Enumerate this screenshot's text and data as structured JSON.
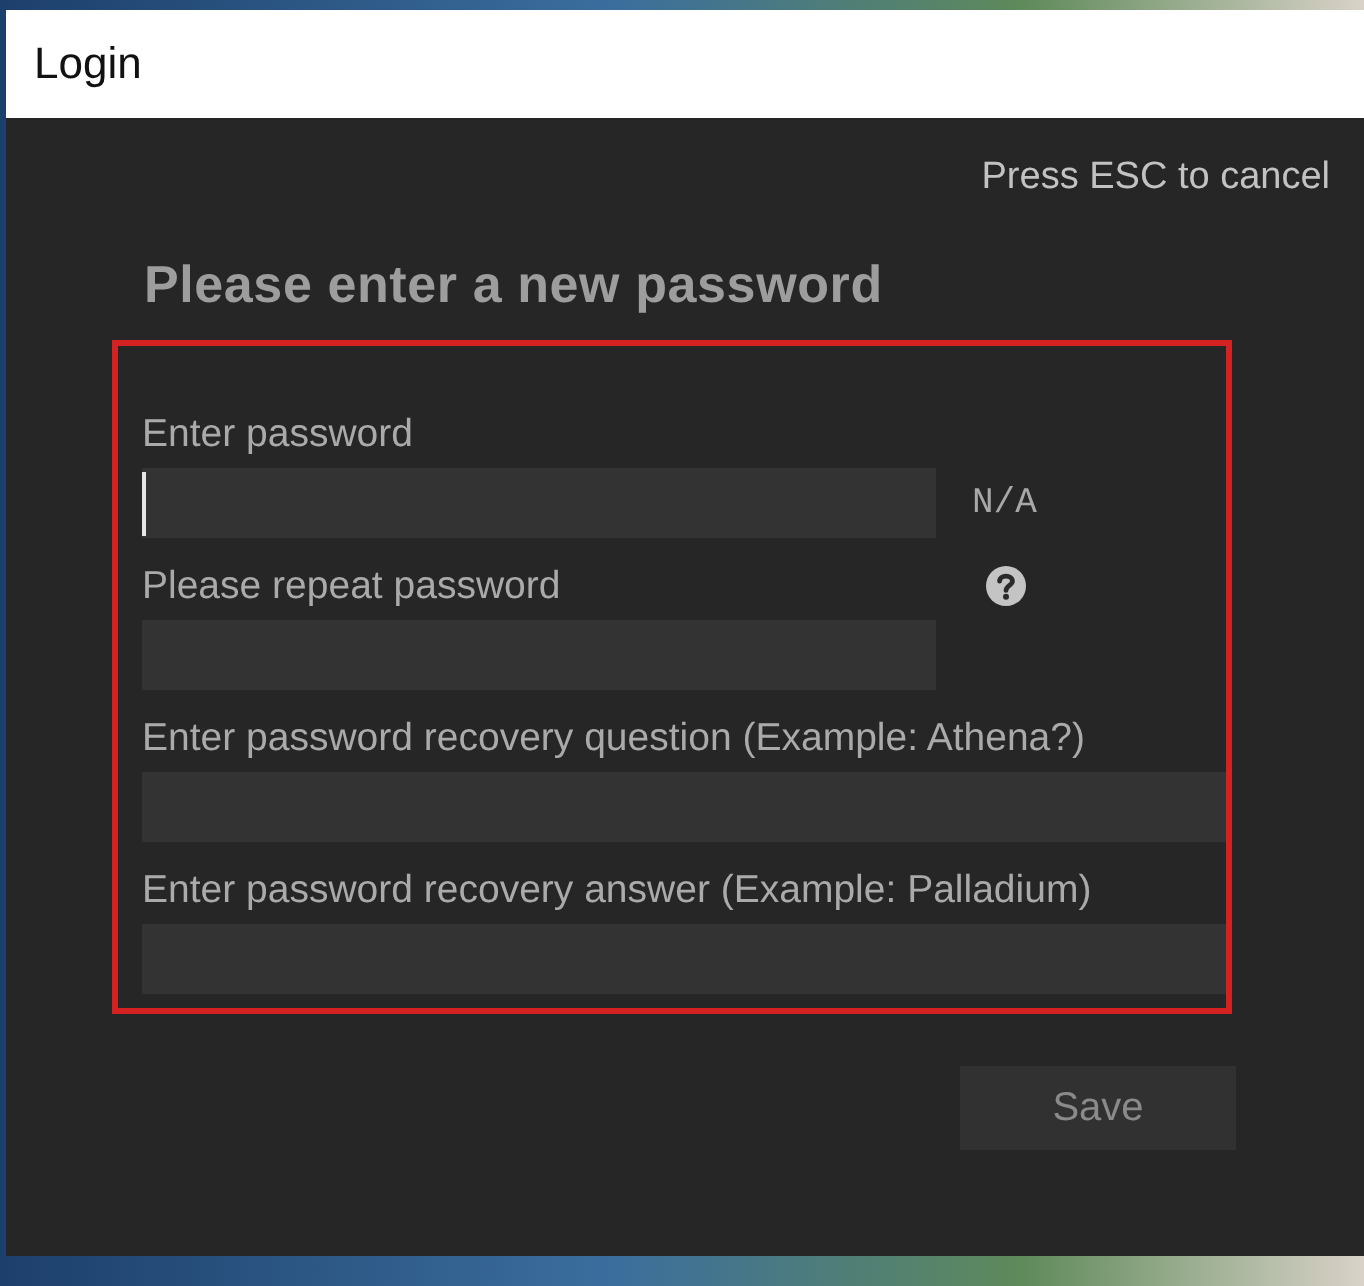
{
  "window": {
    "title": "Login"
  },
  "cancel_hint": "Press ESC to cancel",
  "heading": "Please enter a new password",
  "form": {
    "highlighted": true,
    "fields": [
      {
        "kind": "password",
        "label": "Enter password",
        "focused": true,
        "strength": "N/A"
      },
      {
        "kind": "password",
        "label": "Please repeat password",
        "focused": false,
        "help": true
      },
      {
        "kind": "text",
        "label": "Enter password recovery question (Example: Athena?)",
        "focused": false
      },
      {
        "kind": "text",
        "label": "Enter password recovery answer (Example: Palladium)",
        "focused": false
      }
    ]
  },
  "buttons": [
    {
      "label": "Save",
      "disabled": true
    }
  ]
}
